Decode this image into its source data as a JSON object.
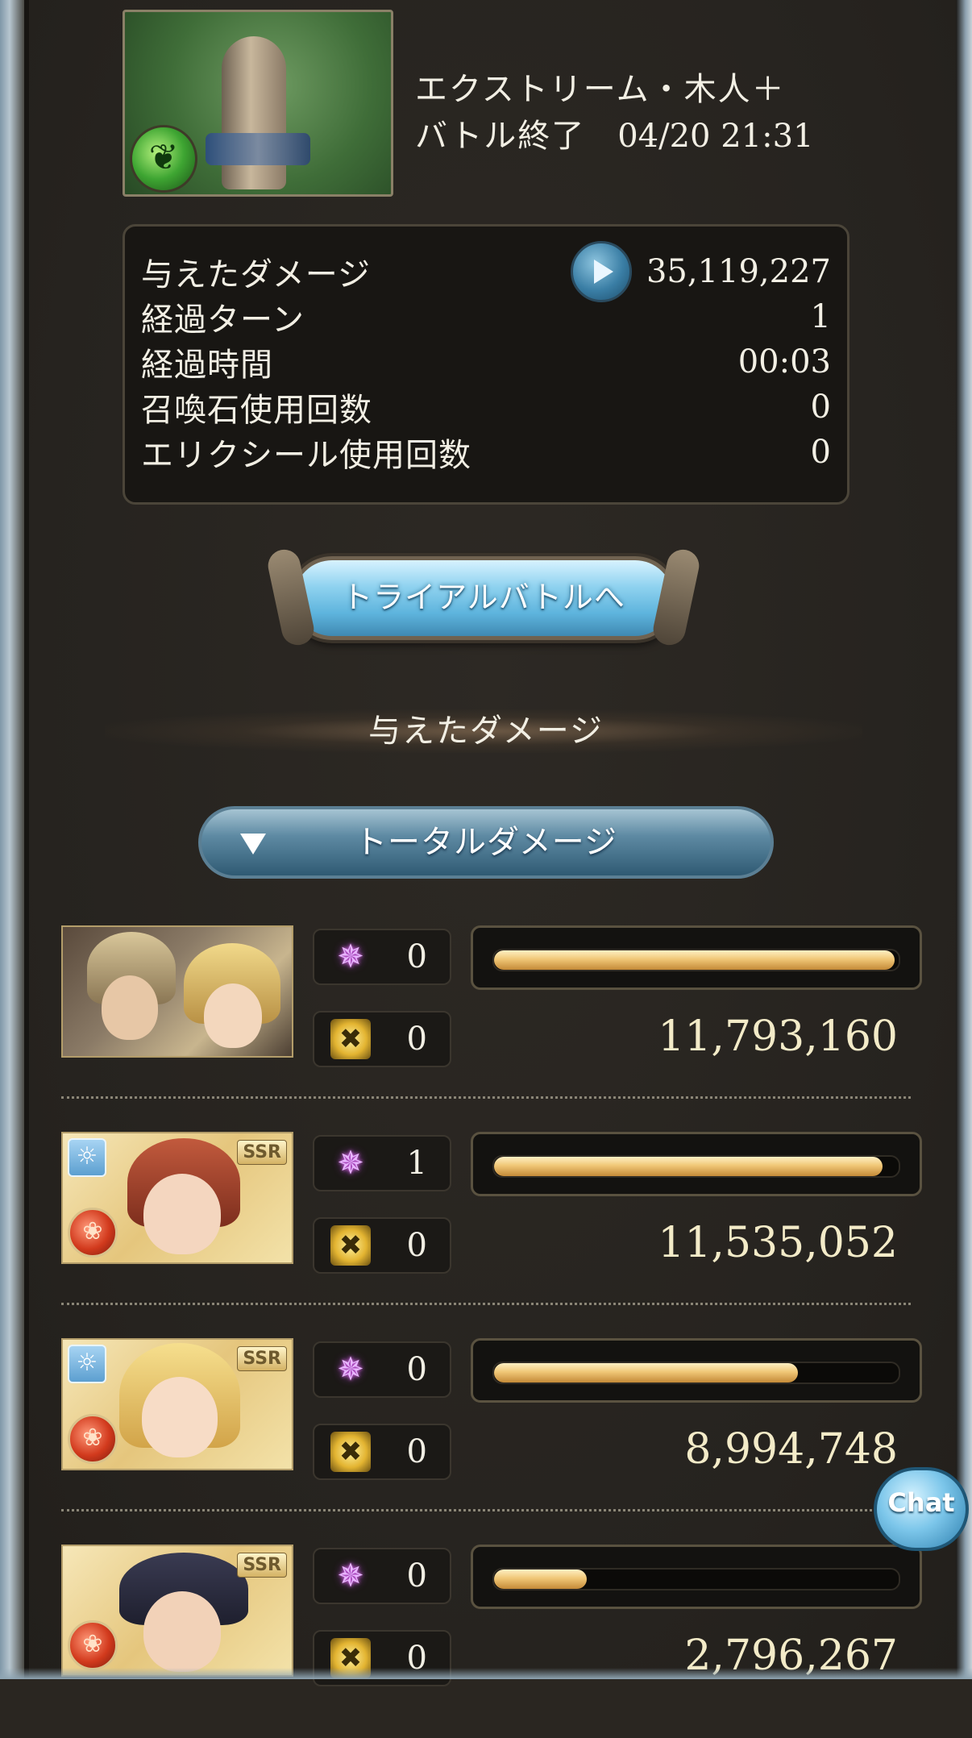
{
  "quest": {
    "title": "エクストリーム・木人＋",
    "status": "バトル終了",
    "datetime": "04/20 21:31",
    "element_icon": "wind-icon"
  },
  "stats": [
    {
      "label": "与えたダメージ",
      "value": "35,119,227"
    },
    {
      "label": "経過ターン",
      "value": "1"
    },
    {
      "label": "経過時間",
      "value": "00:03"
    },
    {
      "label": "召喚石使用回数",
      "value": "0"
    },
    {
      "label": "エリクシール使用回数",
      "value": "0"
    }
  ],
  "trial_button_label": "トライアルバトルへ",
  "section_title": "与えたダメージ",
  "dropdown_label": "トータルダメージ",
  "characters": [
    {
      "ougi_count": "0",
      "skill_count": "0",
      "damage": "11,793,160",
      "bar_fraction": 0.99
    },
    {
      "ougi_count": "1",
      "skill_count": "0",
      "damage": "11,535,052",
      "bar_fraction": 0.96,
      "rarity": "SSR"
    },
    {
      "ougi_count": "0",
      "skill_count": "0",
      "damage": "8,994,748",
      "bar_fraction": 0.75,
      "rarity": "SSR"
    },
    {
      "ougi_count": "0",
      "skill_count": "0",
      "damage": "2,796,267",
      "bar_fraction": 0.23,
      "rarity": "SSR"
    }
  ],
  "chat_label": "Chat",
  "colors": {
    "background": "#2a2621",
    "bar_fill": "#f0c777",
    "button_blue": "#8fd2ef",
    "text": "#f2efe4"
  }
}
